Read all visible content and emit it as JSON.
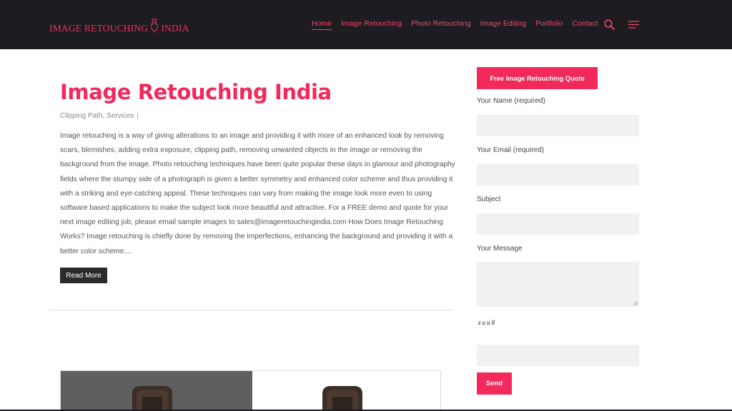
{
  "header": {
    "logo_text_left": "IMAGE RETOUCHING",
    "logo_text_right": "INDIA",
    "logo_icon": "hand-pen-icon",
    "nav": [
      {
        "label": "Home",
        "active": true
      },
      {
        "label": "Image Retouching",
        "active": false
      },
      {
        "label": "Photo Retouching",
        "active": false
      },
      {
        "label": "Image Editing",
        "active": false
      },
      {
        "label": "Portfolio",
        "active": false
      },
      {
        "label": "Contact",
        "active": false
      }
    ],
    "search_icon": "search-icon",
    "menu_icon": "hamburger-menu-icon"
  },
  "post": {
    "title": "Image Retouching India",
    "categories": "Clipping Path, Services",
    "meta_separator": "|",
    "excerpt": "Image retouching is a way of giving alterations to an image and providing it with more of an enhanced look by removing scars, blemishes, adding extra exposure, clipping path, removing unwanted objects in the image or removing the background from the image. Photo retouching techniques have been quite popular these days in glamour and photography fields where the stumpy side of a photograph is given a better symmetry and enhanced color scheme and thus providing it with a striking and eye-catching appeal. These techniques can vary from making the image look more even to using software based applications to make the subject look more beautiful and attractive. For a FREE demo and quote for your next image editing job, please email  sample images to sales@imageretouchingindia.com How Does Image Retouching Works? Image retouching is chiefly done by removing the imperfections, enhancing the background and providing it with a better color scheme....",
    "read_more_label": "Read More"
  },
  "sidebar": {
    "quote_button_label": "Free Image Retouching Quote",
    "name_label": "Your Name (required)",
    "email_label": "Your Email (required)",
    "subject_label": "Subject",
    "message_label": "Your Message",
    "captcha_text": "zuu8",
    "send_label": "Send"
  },
  "colors": {
    "brand": "#f2295b",
    "header_bg": "#1d1c20",
    "button_dark": "#2b2b2b",
    "input_bg": "#f1f1f1"
  }
}
